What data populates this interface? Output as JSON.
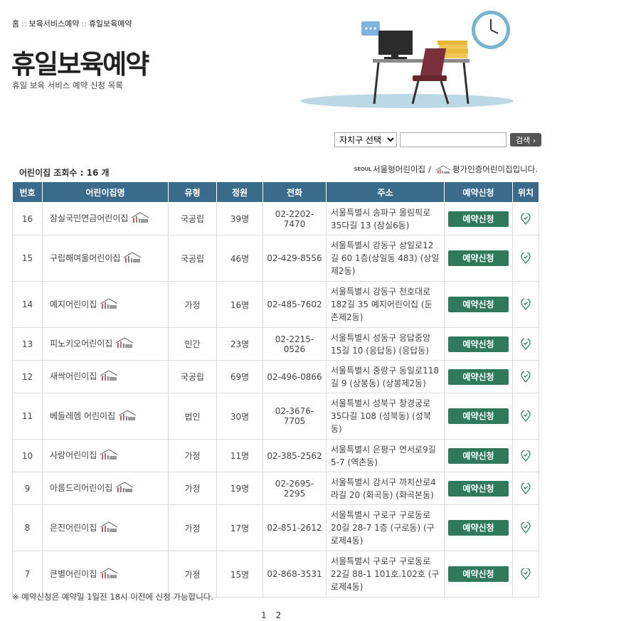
{
  "breadcrumb": {
    "home": "홈",
    "level1": "보육서비스예약",
    "level2": "휴일보육예약",
    "sep": "::"
  },
  "page": {
    "title": "휴일보육예약",
    "subtitle": "휴일 보육 서비스 예약 신청 목록"
  },
  "search": {
    "select_value": "자치구 선택",
    "input_value": "",
    "button_label": "검색"
  },
  "summary": {
    "count_text": "어린이집 조회수 : 16 개"
  },
  "legend": {
    "seoul_logo": "SEOUL",
    "seoul_label": "서울형어린이집",
    "divider": "/",
    "cert_label": "평가인증어린이집입니다."
  },
  "table": {
    "headers": [
      "번호",
      "어린이집명",
      "유형",
      "정원",
      "전화",
      "주소",
      "예약신청",
      "위치"
    ],
    "reserve_label": "예약신청",
    "rows": [
      {
        "no": "16",
        "name": "잠실국민연금어린이집",
        "type": "국공립",
        "capacity": "39명",
        "phone": "02-2202-7470",
        "address": "서울특별시 송파구 올림픽로 35다길 13 (잠실6동)"
      },
      {
        "no": "15",
        "name": "구립해여울어린이집",
        "type": "국공립",
        "capacity": "46명",
        "phone": "02-429-8556",
        "address": "서울특별시 강동구 상일로12길 60 1층(상일동 483) (상일제2동)"
      },
      {
        "no": "14",
        "name": "예지어린이집",
        "type": "가정",
        "capacity": "16명",
        "phone": "02-485-7602",
        "address": "서울특별시 강동구 천호대로 182길 35 예지어린이집 (둔촌제2동)"
      },
      {
        "no": "13",
        "name": "피노키오어린이집",
        "type": "민간",
        "capacity": "23명",
        "phone": "02-2215-0526",
        "address": "서울특별시 성동구 응답중앙15길 10 (응답동) (응답동)"
      },
      {
        "no": "12",
        "name": "새싹어린이집",
        "type": "국공립",
        "capacity": "69명",
        "phone": "02-496-0866",
        "address": "서울특별시 중랑구 동일로118길 9 (상봉동) (상봉제2동)"
      },
      {
        "no": "11",
        "name": "베들레헴 어린이집",
        "type": "법인",
        "capacity": "30명",
        "phone": "02-3676-7705",
        "address": "서울특별시 성북구 창경궁로 35다길 108 (성북동) (성북동)"
      },
      {
        "no": "10",
        "name": "사랑어린이집",
        "type": "가정",
        "capacity": "11명",
        "phone": "02-385-2562",
        "address": "서울특별시 은평구 연서로9길 5-7 (역촌동)"
      },
      {
        "no": "9",
        "name": "아름드리어린이집",
        "type": "가정",
        "capacity": "19명",
        "phone": "02-2695-2295",
        "address": "서울특별시 강서구 까치산로4라길 20 (화곡동) (화곡본동)"
      },
      {
        "no": "8",
        "name": "은진어린이집",
        "type": "가정",
        "capacity": "17명",
        "phone": "02-851-2612",
        "address": "서울특별시 구로구 구로동로 20길 28-7 1층 (구로동) (구로제4동)"
      },
      {
        "no": "7",
        "name": "큰별어린이집",
        "type": "가정",
        "capacity": "15명",
        "phone": "02-868-3531",
        "address": "서울특별시 구로구 구로동로 22길 88-1 101호.102호 (구로제4동)"
      }
    ]
  },
  "note": "※ 예약신청은 예약일 1일전 18시 이전에 신청 가능합니다.",
  "pagination": {
    "pages": [
      "1",
      "2"
    ]
  },
  "colors": {
    "header_bg": "#3a6b8a",
    "reserve_button": "#2f7a5a",
    "search_button": "#555555"
  },
  "icons": {
    "cert": "certified-kindergarten-icon",
    "location": "map-pin-icon",
    "illustration": "desk-clock-illustration"
  }
}
